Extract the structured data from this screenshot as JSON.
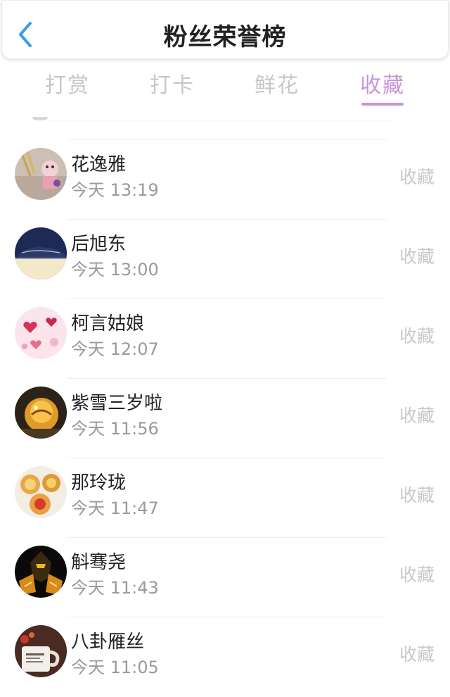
{
  "header": {
    "title": "粉丝荣誉榜",
    "back_icon": "chevron-left-icon",
    "back_color": "#3a9cf0"
  },
  "tabs": [
    {
      "label": "打赏",
      "active": false
    },
    {
      "label": "打卡",
      "active": false
    },
    {
      "label": "鲜花",
      "active": false
    },
    {
      "label": "收藏",
      "active": true
    }
  ],
  "colors": {
    "accent": "#c596d8",
    "inactive_tab": "#c7c7c7",
    "name_text": "#222222",
    "time_text": "#9a9a9a",
    "action_text": "#c9c9c9"
  },
  "fans": [
    {
      "name": "花逸雅",
      "time": "今天 13:19",
      "action": "收藏",
      "avatar": "avatar-photo-clips"
    },
    {
      "name": "后旭东",
      "time": "今天 13:00",
      "action": "收藏",
      "avatar": "avatar-photo-car"
    },
    {
      "name": "柯言姑娘",
      "time": "今天 12:07",
      "action": "收藏",
      "avatar": "avatar-photo-hearts"
    },
    {
      "name": "紫雪三岁啦",
      "time": "今天 11:56",
      "action": "收藏",
      "avatar": "avatar-photo-cake"
    },
    {
      "name": "那玲珑",
      "time": "今天 11:47",
      "action": "收藏",
      "avatar": "avatar-photo-pastry"
    },
    {
      "name": "斛骞尧",
      "time": "今天 11:43",
      "action": "收藏",
      "avatar": "avatar-photo-robot"
    },
    {
      "name": "八卦雁丝",
      "time": "今天 11:05",
      "action": "收藏",
      "avatar": "avatar-photo-mug"
    }
  ]
}
